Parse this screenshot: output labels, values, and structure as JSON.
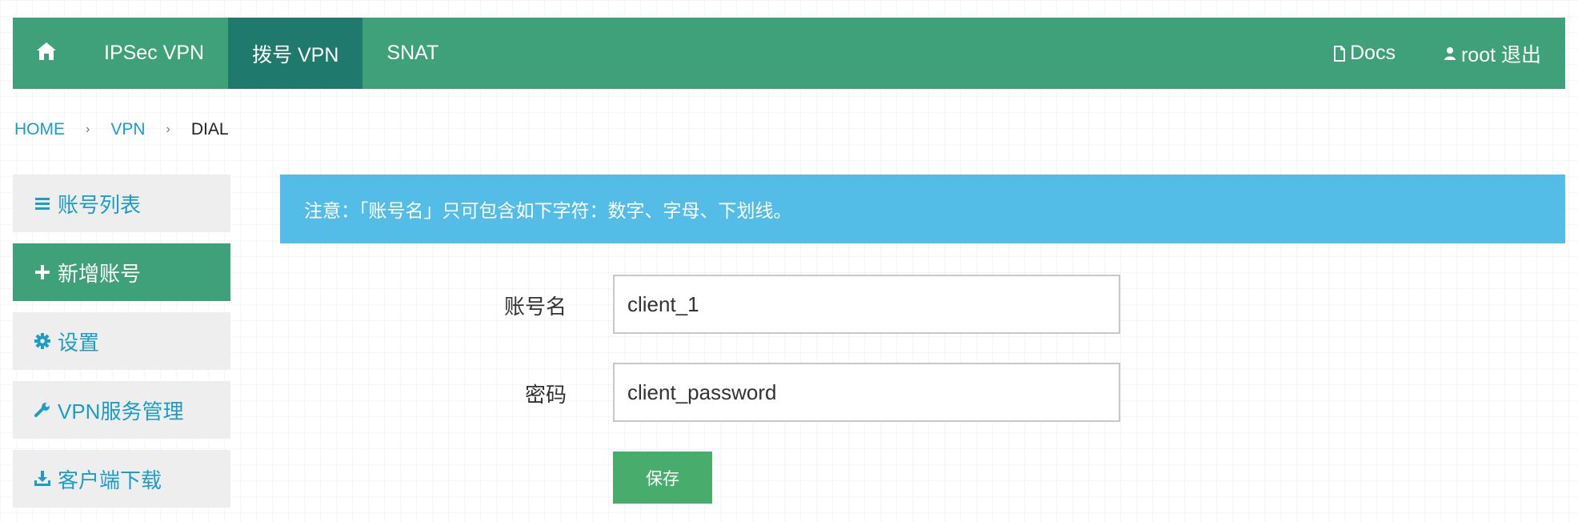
{
  "navbar": {
    "home_icon": "home-icon",
    "items": [
      {
        "label": "IPSec VPN",
        "active": false
      },
      {
        "label": "拨号 VPN",
        "active": true
      },
      {
        "label": "SNAT",
        "active": false
      }
    ],
    "docs": {
      "icon": "document-icon",
      "label": "Docs"
    },
    "user": {
      "icon": "user-icon",
      "label": "root 退出"
    },
    "colors": {
      "bar": "#3ea179",
      "active": "#1f7a6d"
    }
  },
  "breadcrumb": {
    "items": [
      "HOME",
      "VPN"
    ],
    "current": "DIAL",
    "separator": "›"
  },
  "sidebar": {
    "items": [
      {
        "icon": "list-icon",
        "label": "账号列表",
        "active": false
      },
      {
        "icon": "plus-icon",
        "label": "新增账号",
        "active": true
      },
      {
        "icon": "gear-icon",
        "label": "设置",
        "active": false
      },
      {
        "icon": "wrench-icon",
        "label": "VPN服务管理",
        "active": false
      },
      {
        "icon": "download-icon",
        "label": "客户端下载",
        "active": false
      }
    ]
  },
  "alert": {
    "text": "注意：「账号名」只可包含如下字符：数字、字母、下划线。",
    "color": "#53bde8"
  },
  "form": {
    "username": {
      "label": "账号名",
      "value": "client_1"
    },
    "password": {
      "label": "密码",
      "value": "client_password"
    },
    "save_label": "保存",
    "save_color": "#48ad6c"
  }
}
